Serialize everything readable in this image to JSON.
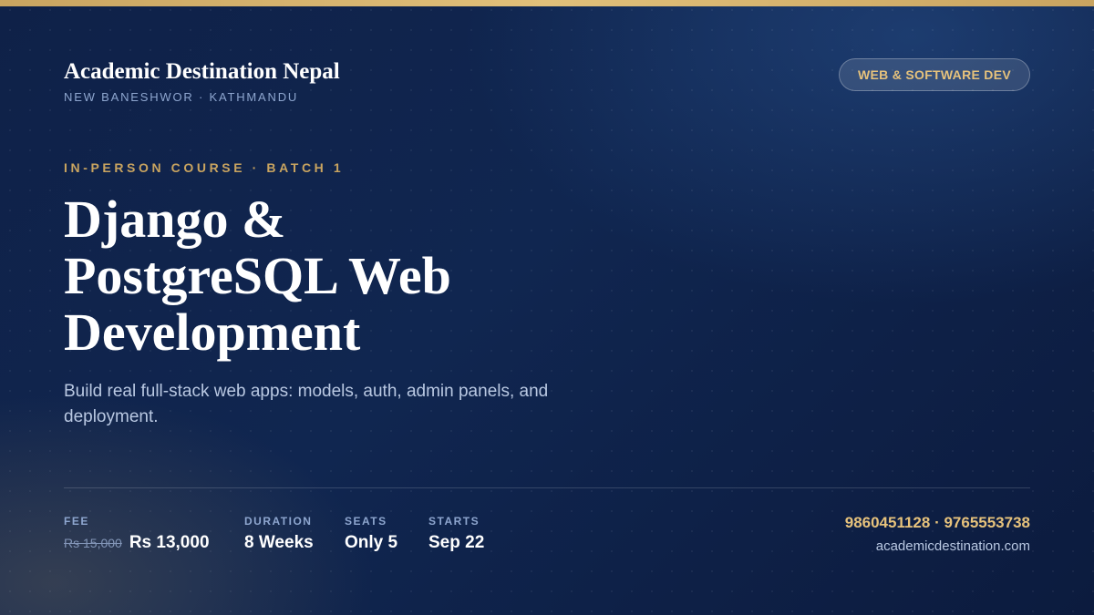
{
  "brand": {
    "name": "Academic Destination Nepal",
    "location": "NEW BANESHWOR · KATHMANDU"
  },
  "badge": "WEB & SOFTWARE DEV",
  "eyebrow": "IN-PERSON COURSE · BATCH 1",
  "title": {
    "line1": "Django &",
    "line2": "PostgreSQL Web",
    "line3": "Development"
  },
  "subtitle": "Build real full-stack web apps: models, auth, admin panels, and deployment.",
  "stats": {
    "fee": {
      "label": "FEE",
      "old": "Rs 15,000",
      "value": "Rs 13,000"
    },
    "duration": {
      "label": "DURATION",
      "value": "8 Weeks"
    },
    "seats": {
      "label": "SEATS",
      "value": "Only 5"
    },
    "starts": {
      "label": "STARTS",
      "value": "Sep 22"
    }
  },
  "contact": {
    "phones": "9860451128 · 9765553738",
    "website": "academicdestination.com"
  },
  "colors": {
    "accent_gold": "#c9a460",
    "background_navy": "#102650",
    "muted_blue": "#8ea6cf"
  }
}
